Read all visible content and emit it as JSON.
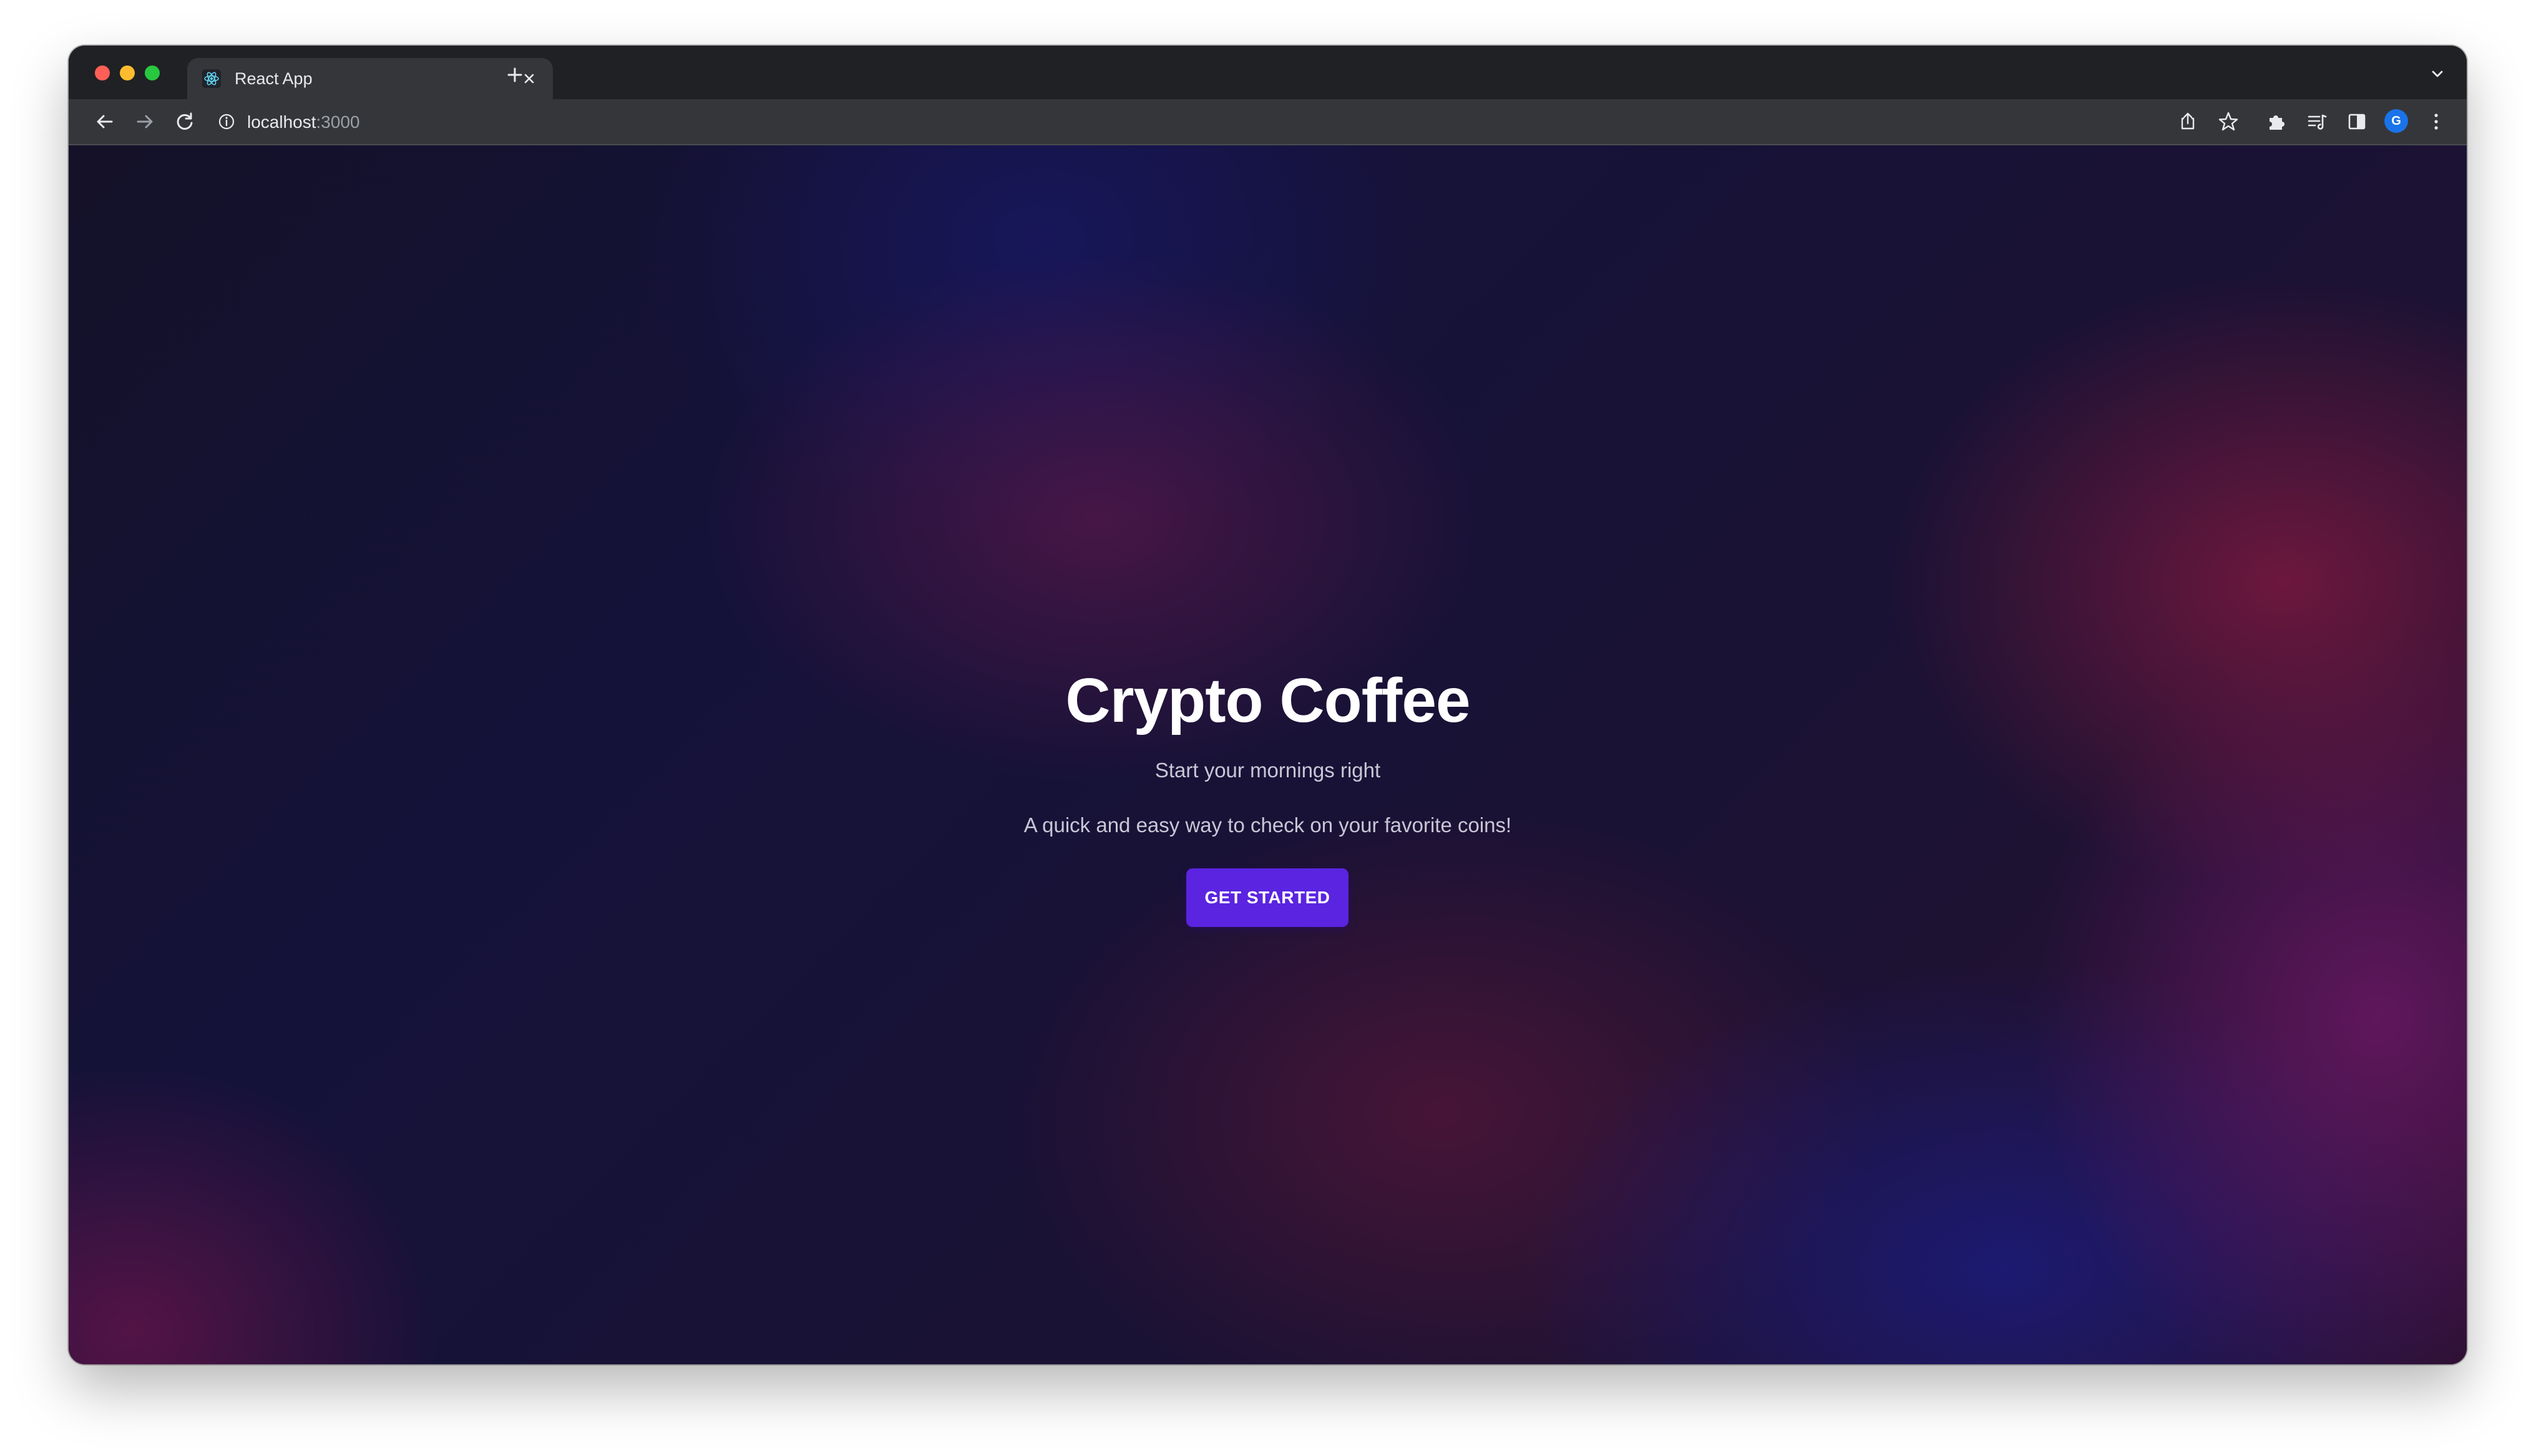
{
  "browser": {
    "tab": {
      "title": "React App",
      "favicon": "react-logo-icon"
    },
    "address_bar": {
      "host": "localhost",
      "port": ":3000"
    },
    "profile_initial": "G",
    "icons": {
      "back": "arrow-back-icon",
      "forward": "arrow-forward-icon",
      "reload": "reload-icon",
      "info": "info-icon",
      "share": "share-icon",
      "bookmark": "star-icon",
      "extensions": "puzzle-icon",
      "reading_list": "reading-list-icon",
      "side_panel": "side-panel-icon",
      "menu": "kebab-menu-icon"
    }
  },
  "page": {
    "title": "Crypto Coffee",
    "subtitle": "Start your mornings right",
    "description": "A quick and easy way to check on your favorite coins!",
    "cta_label": "GET STARTED"
  },
  "colors": {
    "cta_background": "#5a24e0",
    "page_background_dark": "#15123a",
    "accent_red": "#871941",
    "accent_blue": "#191e8c"
  }
}
